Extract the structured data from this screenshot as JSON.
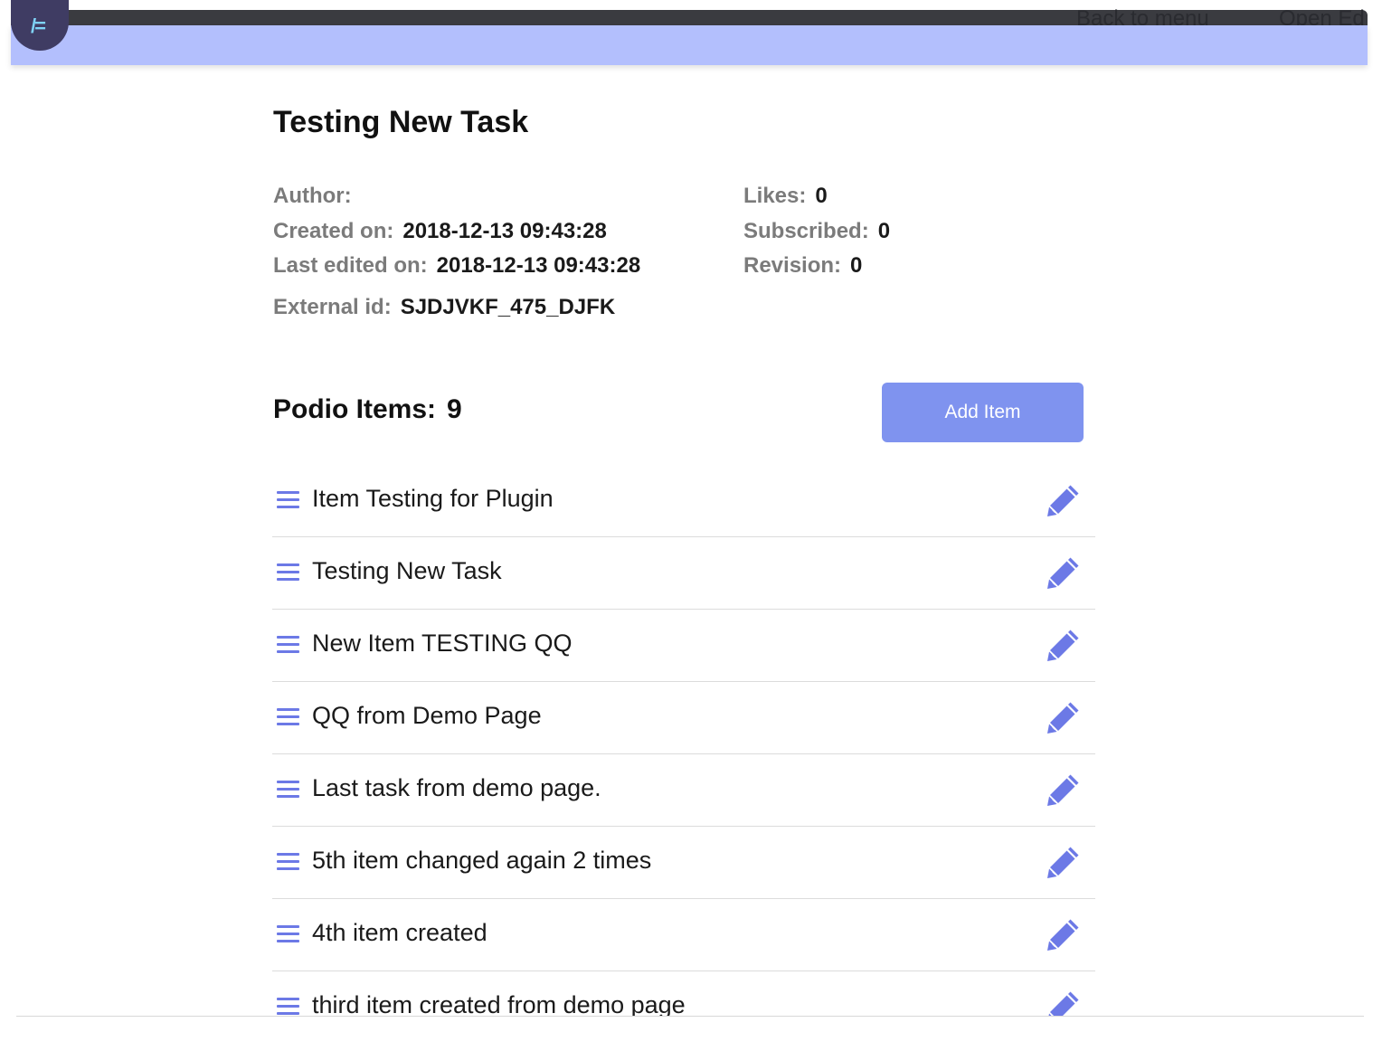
{
  "header": {
    "logo_text": "/=",
    "back_link": "Back to menu",
    "open_link": "Open Ed"
  },
  "task": {
    "title": "Testing New Task",
    "meta_left": [
      {
        "label": "Author:",
        "value": ""
      },
      {
        "label": "Created on:",
        "value": "2018-12-13 09:43:28"
      },
      {
        "label": "Last edited on:",
        "value": "2018-12-13 09:43:28"
      },
      {
        "label": "External id:",
        "value": "SJDJVKF_475_DJFK"
      }
    ],
    "meta_right": [
      {
        "label": "Likes:",
        "value": "0"
      },
      {
        "label": "Subscribed:",
        "value": "0"
      },
      {
        "label": "Revision:",
        "value": "0"
      }
    ]
  },
  "podio": {
    "heading": "Podio Items:",
    "count": "9",
    "add_button": "Add Item",
    "items": [
      {
        "label": "Item Testing for Plugin"
      },
      {
        "label": "Testing New Task"
      },
      {
        "label": "New Item TESTING QQ"
      },
      {
        "label": "QQ from Demo Page"
      },
      {
        "label": "Last task from demo page."
      },
      {
        "label": "5th item changed again 2 times"
      },
      {
        "label": "4th item created"
      },
      {
        "label": "third item created from demo page"
      }
    ]
  },
  "colors": {
    "accent": "#6c79e6",
    "button": "#7f93ef",
    "header_light": "#b3bffd",
    "header_dark": "#3a3b40"
  },
  "icons": {
    "row_drag": "menu-icon",
    "row_edit": "pencil-icon"
  }
}
